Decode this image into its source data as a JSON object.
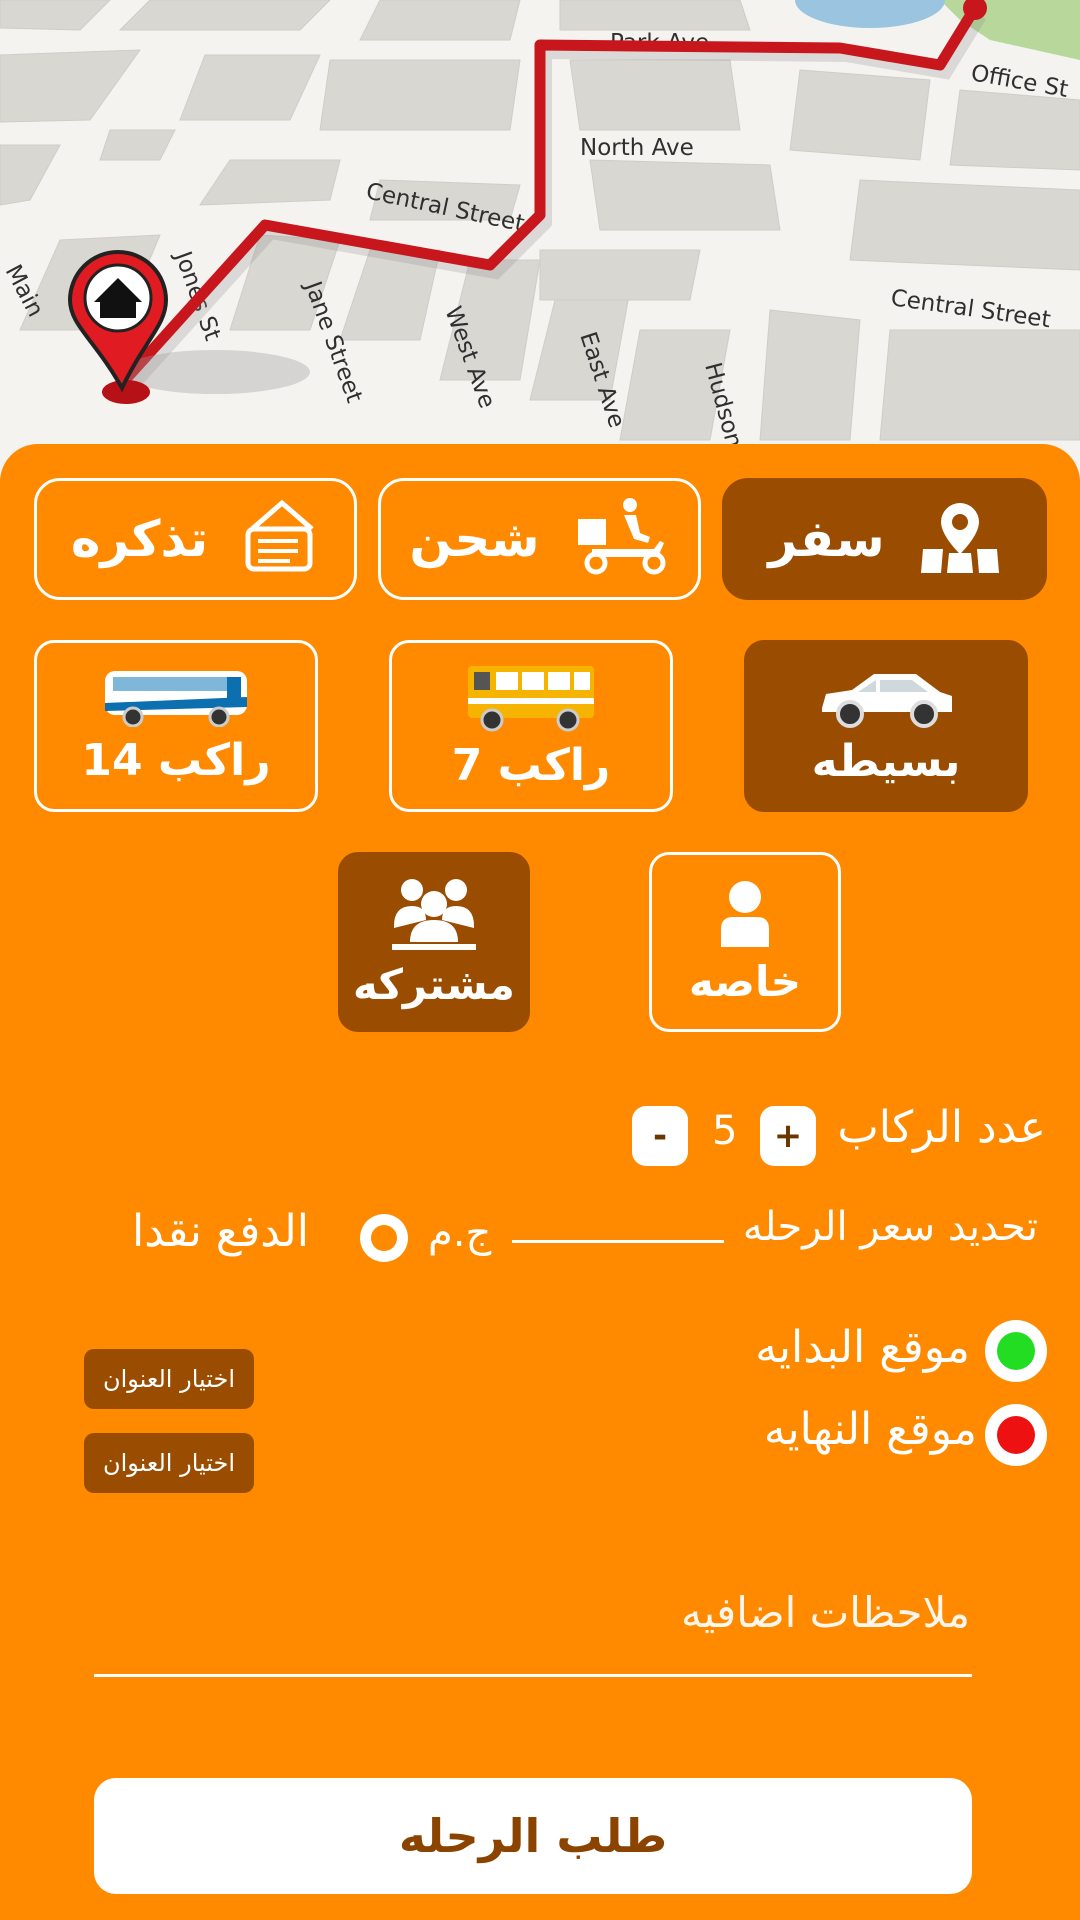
{
  "map": {
    "streets": [
      "Park Ave",
      "Office St",
      "North Ave",
      "Central Street",
      "Central Street",
      "Main",
      "Jane Street",
      "West Ave",
      "East Ave",
      "Hudson",
      "Jones St"
    ],
    "pin_icon": "home-pin-icon"
  },
  "service_tabs": [
    {
      "label": "سفر",
      "icon": "map-location-icon",
      "active": true
    },
    {
      "label": "شحن",
      "icon": "delivery-scooter-icon",
      "active": false
    },
    {
      "label": "تذكره",
      "icon": "ticket-icon",
      "active": false
    }
  ],
  "vehicles": [
    {
      "label": "بسيطه",
      "icon": "car-icon",
      "active": true
    },
    {
      "label": "راكب 7",
      "icon": "minibus-icon",
      "active": false
    },
    {
      "label": "راكب 14",
      "icon": "bus-icon",
      "active": false
    }
  ],
  "ride_types": [
    {
      "label": "خاصه",
      "icon": "person-icon",
      "active": false
    },
    {
      "label": "مشتركه",
      "icon": "group-icon",
      "active": true
    }
  ],
  "passengers": {
    "label": "عدد الركاب",
    "plus": "+",
    "minus": "-",
    "count": "5"
  },
  "price": {
    "label": "تحديد سعر الرحله",
    "currency": "ج.م",
    "cash_label": "الدفع نقدا"
  },
  "locations": {
    "start_label": "موقع البدايه",
    "end_label": "موقع النهايه",
    "choose_address": "اختيار العنوان",
    "start_color": "#22dd22",
    "end_color": "#ee1111"
  },
  "notes": {
    "placeholder": "ملاحظات اضافيه"
  },
  "submit": {
    "label": "طلب الرحله"
  },
  "colors": {
    "panel": "#ff8a00",
    "active": "#9a4d00",
    "route": "#c8161d"
  }
}
